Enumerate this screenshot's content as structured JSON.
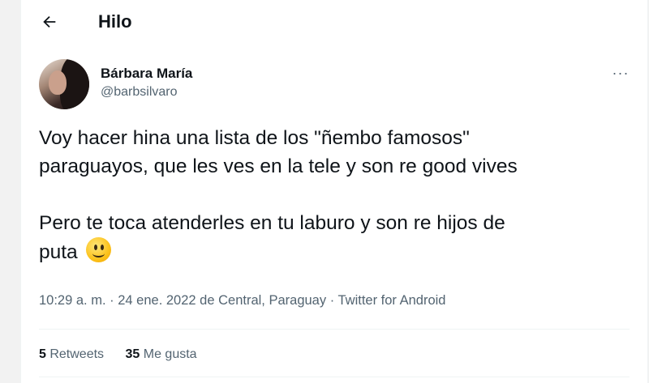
{
  "header": {
    "title": "Hilo",
    "back_icon": "arrow-left-icon"
  },
  "tweet": {
    "author": {
      "display_name": "Bárbara María",
      "handle": "@barbsilvaro",
      "more_icon": "more-dots-icon",
      "more_glyph": "···"
    },
    "text": {
      "paragraph1": "Voy hacer hina una lista de los \"ñembo famosos\"\nparaguayos, que les ves en la tele y son re good vives",
      "paragraph2": "Pero te toca atenderles en tu laburo y son re hijos de\nputa",
      "emoji": "slightly-smiling-face-icon"
    },
    "meta": {
      "time": "10:29 a. m.",
      "sep1": " · ",
      "date": "24 ene. 2022",
      "location_prefix": " de ",
      "location": "Central, Paraguay",
      "sep2": " · ",
      "source": "Twitter for Android"
    },
    "stats": {
      "retweets_count": "5",
      "retweets_label": " Retweets",
      "likes_count": "35",
      "likes_label": " Me gusta"
    }
  },
  "colors": {
    "text": "#0f1419",
    "secondary": "#536471",
    "border": "#eff3f4",
    "background": "#ffffff"
  }
}
